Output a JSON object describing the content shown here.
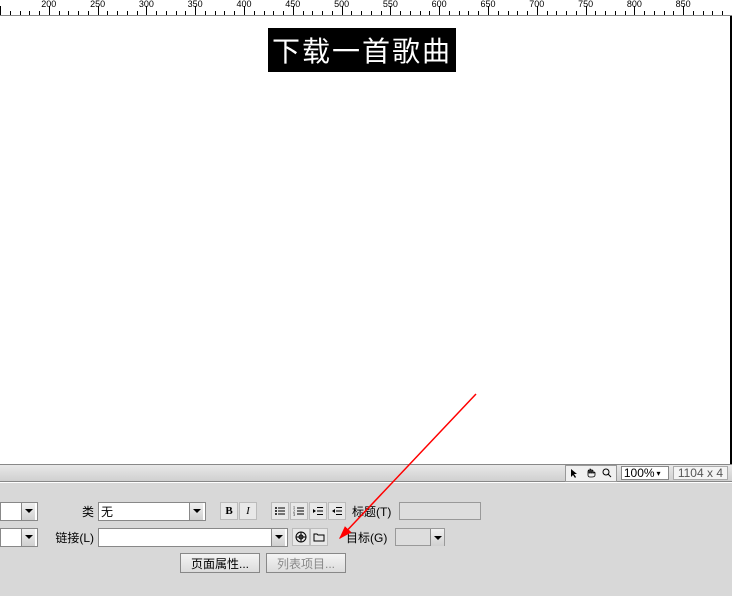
{
  "ruler": {
    "start": 150,
    "step_minor": 10,
    "step_major": 50,
    "labels": [
      200,
      250,
      300,
      350,
      400,
      450,
      500,
      550,
      600,
      650,
      700,
      750,
      800,
      850
    ]
  },
  "canvas": {
    "heading": "下载一首歌曲"
  },
  "status": {
    "zoom": "100%",
    "dimensions": "1104 x 4"
  },
  "properties": {
    "class_label": "类",
    "class_value": "无",
    "link_label": "链接(L)",
    "link_value": "",
    "bold": "B",
    "italic": "I",
    "title_label": "标题(T)",
    "title_value": "",
    "target_label": "目标(G)",
    "target_value": "",
    "page_properties_btn": "页面属性...",
    "list_item_btn": "列表项目..."
  }
}
